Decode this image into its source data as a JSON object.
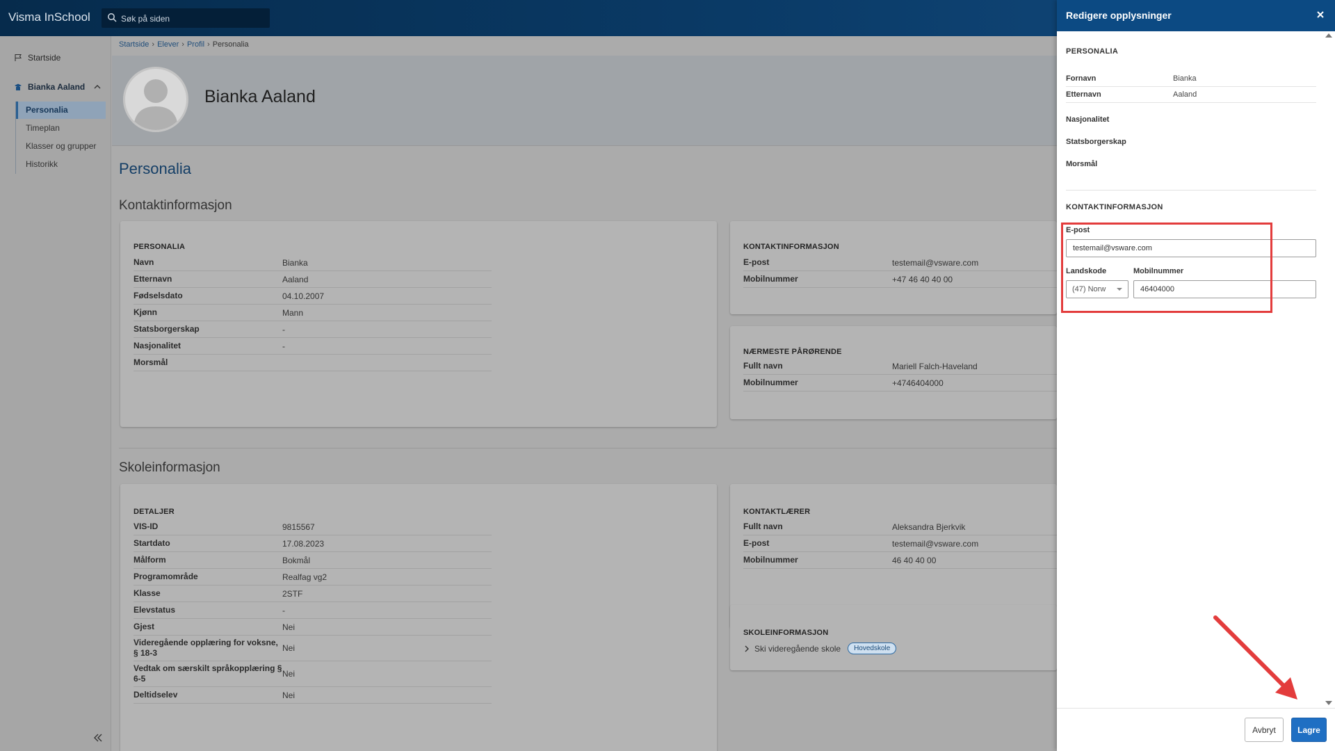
{
  "app": {
    "brand": "Visma InSchool",
    "search_placeholder": "Søk på siden"
  },
  "sidebar": {
    "home": "Startside",
    "user": "Bianka Aaland",
    "items": [
      {
        "label": "Personalia",
        "active": true
      },
      {
        "label": "Timeplan",
        "active": false
      },
      {
        "label": "Klasser og grupper",
        "active": false
      },
      {
        "label": "Historikk",
        "active": false
      }
    ]
  },
  "breadcrumb": [
    "Startside",
    "Elever",
    "Profil",
    "Personalia"
  ],
  "profile": {
    "name": "Bianka Aaland"
  },
  "page": {
    "title": "Personalia",
    "contact_heading": "Kontaktinformasjon",
    "school_heading": "Skoleinformasjon"
  },
  "personalia_card": {
    "title": "PERSONALIA",
    "rows": [
      {
        "k": "Navn",
        "v": "Bianka"
      },
      {
        "k": "Etternavn",
        "v": "Aaland"
      },
      {
        "k": "Fødselsdato",
        "v": "04.10.2007"
      },
      {
        "k": "Kjønn",
        "v": "Mann"
      },
      {
        "k": "Statsborgerskap",
        "v": "-"
      },
      {
        "k": "Nasjonalitet",
        "v": "-"
      },
      {
        "k": "Morsmål",
        "v": ""
      }
    ]
  },
  "contact_card": {
    "title": "KONTAKTINFORMASJON",
    "rows": [
      {
        "k": "E-post",
        "v": "testemail@vsware.com"
      },
      {
        "k": "Mobilnummer",
        "v": "+47 46 40 40 00"
      }
    ]
  },
  "relative_card": {
    "title": "NÆRMESTE PÅRØRENDE",
    "rows": [
      {
        "k": "Fullt navn",
        "v": "Mariell Falch-Haveland"
      },
      {
        "k": "Mobilnummer",
        "v": "+4746404000"
      }
    ]
  },
  "details_card": {
    "title": "DETALJER",
    "rows": [
      {
        "k": "VIS-ID",
        "v": "9815567"
      },
      {
        "k": "Startdato",
        "v": "17.08.2023"
      },
      {
        "k": "Målform",
        "v": "Bokmål"
      },
      {
        "k": "Programområde",
        "v": "Realfag vg2"
      },
      {
        "k": "Klasse",
        "v": "2STF"
      },
      {
        "k": "Elevstatus",
        "v": "-"
      },
      {
        "k": "Gjest",
        "v": "Nei"
      },
      {
        "k": "Videregående opplæring for voksne, § 18-3",
        "v": "Nei"
      },
      {
        "k": "Vedtak om særskilt språkopplæring § 6-5",
        "v": "Nei"
      },
      {
        "k": "Deltidselev",
        "v": "Nei"
      }
    ]
  },
  "teacher_card": {
    "title": "KONTAKTLÆRER",
    "rows": [
      {
        "k": "Fullt navn",
        "v": "Aleksandra Bjerkvik"
      },
      {
        "k": "E-post",
        "v": "testemail@vsware.com"
      },
      {
        "k": "Mobilnummer",
        "v": "46 40 40 00"
      }
    ]
  },
  "school_card": {
    "title": "SKOLEINFORMASJON",
    "school": "Ski videregående skole",
    "badge": "Hovedskole"
  },
  "drawer": {
    "title": "Redigere opplysninger",
    "personalia_title": "PERSONALIA",
    "rows": [
      {
        "k": "Fornavn",
        "v": "Bianka"
      },
      {
        "k": "Etternavn",
        "v": "Aaland"
      }
    ],
    "labels": [
      "Nasjonalitet",
      "Statsborgerskap",
      "Morsmål"
    ],
    "contact_title": "KONTAKTINFORMASJON",
    "email_label": "E-post",
    "email_value": "testemail@vsware.com",
    "country_label": "Landskode",
    "country_value": "(47) Norw",
    "mobile_label": "Mobilnummer",
    "mobile_value": "46404000",
    "cancel": "Avbryt",
    "save": "Lagre"
  },
  "colors": {
    "header": "#0c4a83",
    "primary_button": "#1f6fc3",
    "highlight": "#e33c3c",
    "arrow": "#e33c3c"
  }
}
